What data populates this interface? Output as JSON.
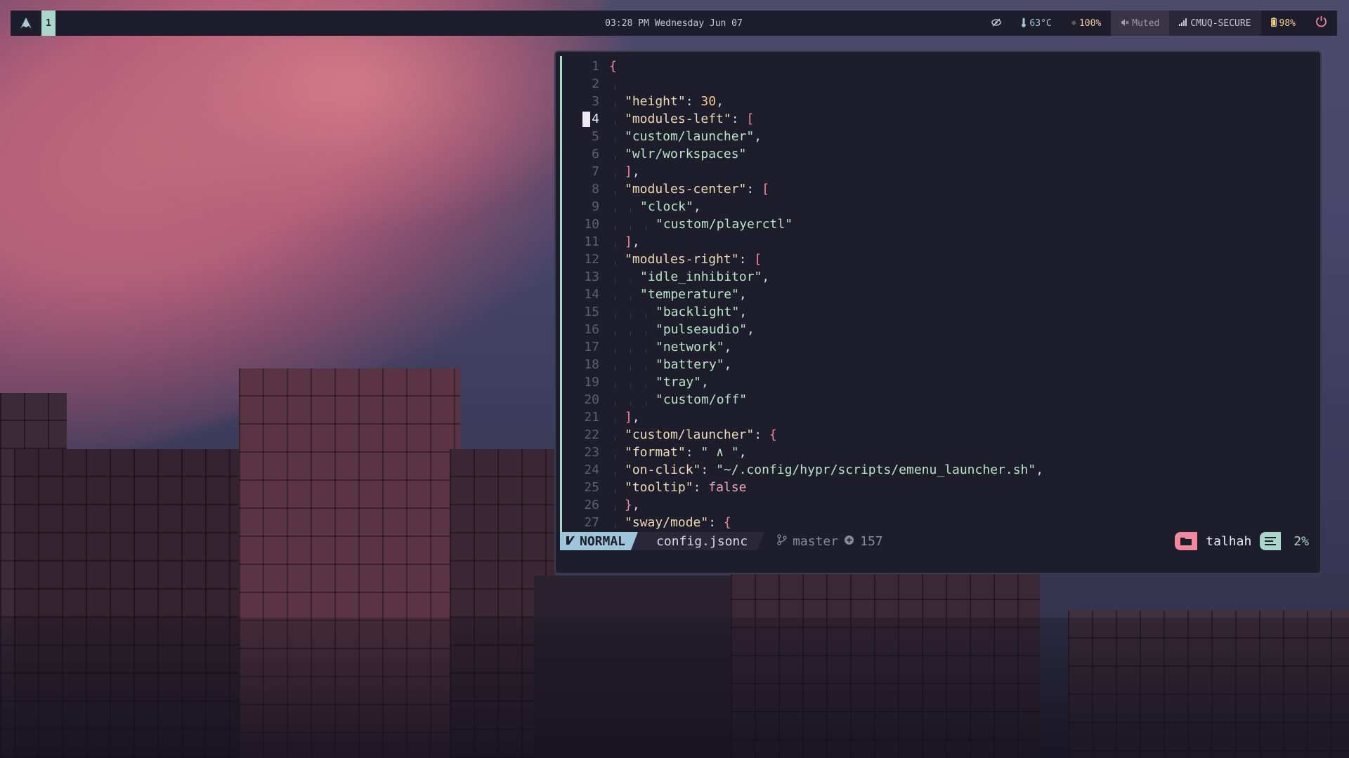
{
  "topbar": {
    "launcher_icon": "arch-logo-icon",
    "workspace": "1",
    "clock": "03:28 PM  Wednesday Jun 07",
    "idle_icon": "eye-off-icon",
    "temperature": "63°C",
    "backlight": "100%",
    "audio": "Muted",
    "network": "CMUQ-SECURE",
    "battery": "98%",
    "power_icon": "power-icon"
  },
  "editor": {
    "lines": [
      {
        "n": "1",
        "indent": 0,
        "parts": [
          {
            "t": "{",
            "c": "b"
          }
        ]
      },
      {
        "n": "2",
        "indent": 1,
        "parts": []
      },
      {
        "n": "3",
        "indent": 1,
        "parts": [
          {
            "t": "\"height\"",
            "c": "k"
          },
          {
            "t": ": ",
            "c": "p"
          },
          {
            "t": "30",
            "c": "n"
          },
          {
            "t": ",",
            "c": "p"
          }
        ]
      },
      {
        "n": "4",
        "indent": 1,
        "cur": true,
        "parts": [
          {
            "t": "\"modules-left\"",
            "c": "k"
          },
          {
            "t": ": ",
            "c": "p"
          },
          {
            "t": "[",
            "c": "b"
          }
        ]
      },
      {
        "n": "5",
        "indent": 1,
        "parts": [
          {
            "t": "\"custom/launcher\"",
            "c": "s"
          },
          {
            "t": ",",
            "c": "p"
          }
        ]
      },
      {
        "n": "6",
        "indent": 1,
        "parts": [
          {
            "t": "\"wlr/workspaces\"",
            "c": "s"
          }
        ]
      },
      {
        "n": "7",
        "indent": 1,
        "parts": [
          {
            "t": "]",
            "c": "b"
          },
          {
            "t": ",",
            "c": "p"
          }
        ]
      },
      {
        "n": "8",
        "indent": 1,
        "parts": [
          {
            "t": "\"modules-center\"",
            "c": "k"
          },
          {
            "t": ": ",
            "c": "p"
          },
          {
            "t": "[",
            "c": "b"
          }
        ]
      },
      {
        "n": "9",
        "indent": 2,
        "parts": [
          {
            "t": "\"clock\"",
            "c": "s"
          },
          {
            "t": ",",
            "c": "p"
          }
        ]
      },
      {
        "n": "10",
        "indent": 3,
        "parts": [
          {
            "t": "\"custom/playerctl\"",
            "c": "s"
          }
        ]
      },
      {
        "n": "11",
        "indent": 1,
        "parts": [
          {
            "t": "]",
            "c": "b"
          },
          {
            "t": ",",
            "c": "p"
          }
        ]
      },
      {
        "n": "12",
        "indent": 1,
        "parts": [
          {
            "t": "\"modules-right\"",
            "c": "k"
          },
          {
            "t": ": ",
            "c": "p"
          },
          {
            "t": "[",
            "c": "b"
          }
        ]
      },
      {
        "n": "13",
        "indent": 2,
        "parts": [
          {
            "t": "\"idle_inhibitor\"",
            "c": "s"
          },
          {
            "t": ",",
            "c": "p"
          }
        ]
      },
      {
        "n": "14",
        "indent": 2,
        "parts": [
          {
            "t": "\"temperature\"",
            "c": "s"
          },
          {
            "t": ",",
            "c": "p"
          }
        ]
      },
      {
        "n": "15",
        "indent": 3,
        "parts": [
          {
            "t": "\"backlight\"",
            "c": "s"
          },
          {
            "t": ",",
            "c": "p"
          }
        ]
      },
      {
        "n": "16",
        "indent": 3,
        "parts": [
          {
            "t": "\"pulseaudio\"",
            "c": "s"
          },
          {
            "t": ",",
            "c": "p"
          }
        ]
      },
      {
        "n": "17",
        "indent": 3,
        "parts": [
          {
            "t": "\"network\"",
            "c": "s"
          },
          {
            "t": ",",
            "c": "p"
          }
        ]
      },
      {
        "n": "18",
        "indent": 3,
        "parts": [
          {
            "t": "\"battery\"",
            "c": "s"
          },
          {
            "t": ",",
            "c": "p"
          }
        ]
      },
      {
        "n": "19",
        "indent": 3,
        "parts": [
          {
            "t": "\"tray\"",
            "c": "s"
          },
          {
            "t": ",",
            "c": "p"
          }
        ]
      },
      {
        "n": "20",
        "indent": 3,
        "parts": [
          {
            "t": "\"custom/off\"",
            "c": "s"
          }
        ]
      },
      {
        "n": "21",
        "indent": 1,
        "parts": [
          {
            "t": "]",
            "c": "b"
          },
          {
            "t": ",",
            "c": "p"
          }
        ]
      },
      {
        "n": "22",
        "indent": 1,
        "parts": [
          {
            "t": "\"custom/launcher\"",
            "c": "k"
          },
          {
            "t": ": ",
            "c": "p"
          },
          {
            "t": "{",
            "c": "b"
          }
        ]
      },
      {
        "n": "23",
        "indent": 1,
        "parts": [
          {
            "t": "\"format\"",
            "c": "k"
          },
          {
            "t": ": ",
            "c": "p"
          },
          {
            "t": "\" ∧ \"",
            "c": "s"
          },
          {
            "t": ",",
            "c": "p"
          }
        ]
      },
      {
        "n": "24",
        "indent": 1,
        "parts": [
          {
            "t": "\"on-click\"",
            "c": "k"
          },
          {
            "t": ": ",
            "c": "p"
          },
          {
            "t": "\"~/.config/hypr/scripts/emenu_launcher.sh\"",
            "c": "s"
          },
          {
            "t": ",",
            "c": "p"
          }
        ]
      },
      {
        "n": "25",
        "indent": 1,
        "parts": [
          {
            "t": "\"tooltip\"",
            "c": "k"
          },
          {
            "t": ": ",
            "c": "p"
          },
          {
            "t": "false",
            "c": "kw"
          }
        ]
      },
      {
        "n": "26",
        "indent": 1,
        "parts": [
          {
            "t": "}",
            "c": "b"
          },
          {
            "t": ",",
            "c": "p"
          }
        ]
      },
      {
        "n": "27",
        "indent": 1,
        "parts": [
          {
            "t": "\"sway/mode\"",
            "c": "k"
          },
          {
            "t": ": ",
            "c": "p"
          },
          {
            "t": "{",
            "c": "b"
          }
        ]
      }
    ],
    "status": {
      "mode": "NORMAL",
      "file": "config.jsonc",
      "branch": "master",
      "changes": "157",
      "user": "talhah",
      "percent": "2%"
    }
  },
  "colors": {
    "bar_bg": "#1e1d2b",
    "accent_teal": "#a9d6c8",
    "accent_blue": "#9fc6d8",
    "accent_pink": "#f0899e"
  }
}
